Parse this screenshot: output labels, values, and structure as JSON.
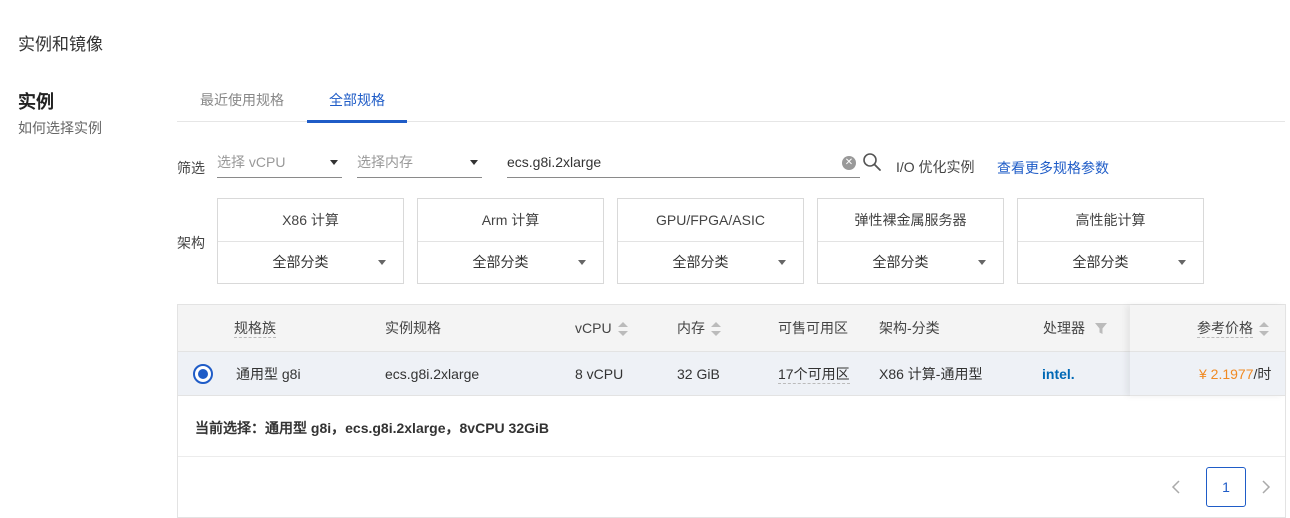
{
  "section": {
    "title": "实例和镜像"
  },
  "sidebar": {
    "title": "实例",
    "link": "如何选择实例"
  },
  "tabs": [
    {
      "label": "最近使用规格",
      "active": false
    },
    {
      "label": "全部规格",
      "active": true
    }
  ],
  "filter": {
    "label": "筛选",
    "vcpu_placeholder": "选择 vCPU",
    "memory_placeholder": "选择内存",
    "search_value": "ecs.g8i.2xlarge",
    "io_label": "I/O 优化实例",
    "more_link": "查看更多规格参数"
  },
  "arch": {
    "label": "架构",
    "items": [
      {
        "title": "X86 计算",
        "option": "全部分类"
      },
      {
        "title": "Arm 计算",
        "option": "全部分类"
      },
      {
        "title": "GPU/FPGA/ASIC",
        "option": "全部分类"
      },
      {
        "title": "弹性裸金属服务器",
        "option": "全部分类"
      },
      {
        "title": "高性能计算",
        "option": "全部分类"
      }
    ]
  },
  "table": {
    "headers": {
      "family": "规格族",
      "spec": "实例规格",
      "vcpu": "vCPU",
      "memory": "内存",
      "zones": "可售可用区",
      "arch": "架构-分类",
      "cpu": "处理器",
      "price": "参考价格"
    },
    "rows": [
      {
        "family": "通用型 g8i",
        "spec": "ecs.g8i.2xlarge",
        "vcpu": "8 vCPU",
        "memory": "32 GiB",
        "zones": "17个可用区",
        "arch": "X86 计算-通用型",
        "cpu_logo": "intel.",
        "price": "¥ 2.1977",
        "price_unit": "/时",
        "selected": true
      }
    ],
    "summary": "当前选择：通用型 g8i，ecs.g8i.2xlarge，8vCPU 32GiB"
  },
  "pagination": {
    "current": "1"
  },
  "colors": {
    "accent": "#1f5cc7",
    "price": "#f08a24",
    "intel": "#0068b5"
  }
}
